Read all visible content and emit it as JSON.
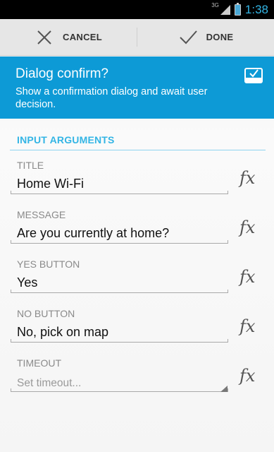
{
  "status_bar": {
    "network": "3G",
    "time": "1:38"
  },
  "action_bar": {
    "cancel_label": "CANCEL",
    "done_label": "DONE"
  },
  "header": {
    "title": "Dialog confirm?",
    "subtitle": "Show a confirmation dialog and await user decision."
  },
  "section": {
    "title": "INPUT ARGUMENTS"
  },
  "fields": [
    {
      "label": "TITLE",
      "value": "Home Wi-Fi"
    },
    {
      "label": "MESSAGE",
      "value": "Are you currently at home?"
    },
    {
      "label": "YES BUTTON",
      "value": "Yes"
    },
    {
      "label": "NO BUTTON",
      "value": "No, pick on map"
    },
    {
      "label": "TIMEOUT",
      "placeholder": "Set timeout..."
    }
  ],
  "fx_symbol": "fx",
  "colors": {
    "accent": "#33b5e5",
    "header_bg": "#0d9ad6"
  }
}
